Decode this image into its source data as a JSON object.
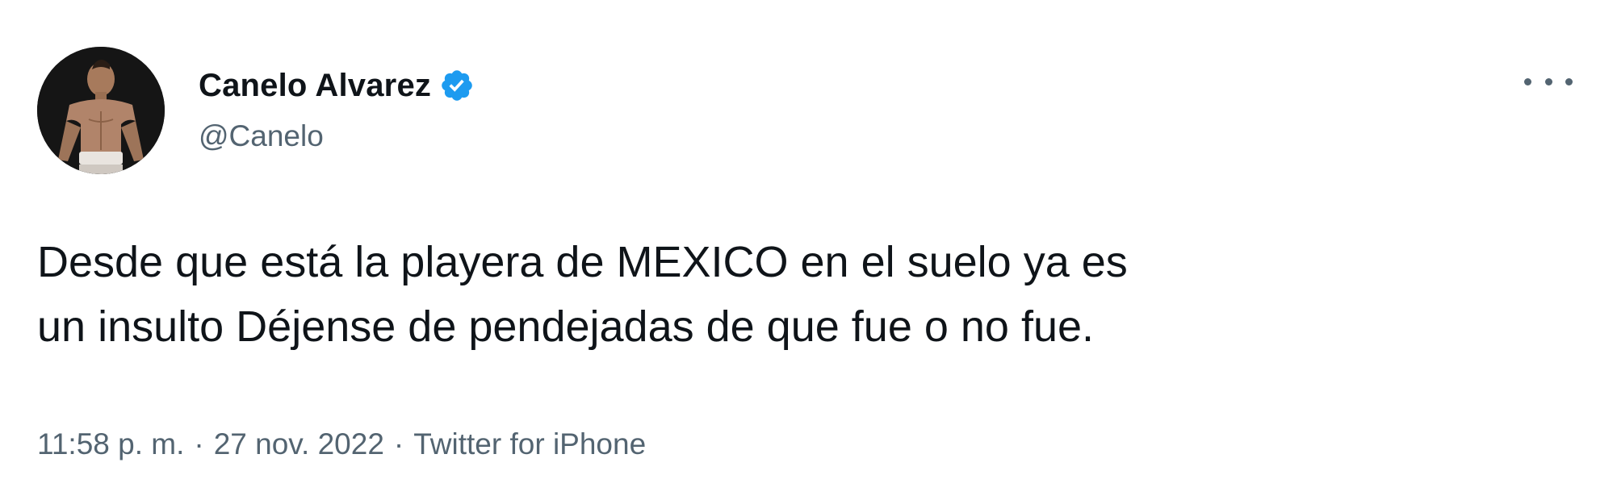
{
  "user": {
    "display_name": "Canelo Alvarez",
    "handle": "@Canelo",
    "verified": true,
    "avatar_icon": "profile-photo"
  },
  "tweet": {
    "lines": [
      "Desde que está la playera de MEXICO en el suelo ya es",
      "un insulto Déjense de pendejadas de que fue o no fue."
    ]
  },
  "meta": {
    "time": "11:58 p. m.",
    "separator": "·",
    "date": "27 nov. 2022",
    "source": "Twitter for iPhone"
  },
  "icons": {
    "more": "more-dots-icon",
    "verified": "verified-badge-icon"
  },
  "colors": {
    "primary_text": "#0f1419",
    "secondary_text": "#536471",
    "verified_blue": "#1d9bf0",
    "background": "#ffffff"
  }
}
